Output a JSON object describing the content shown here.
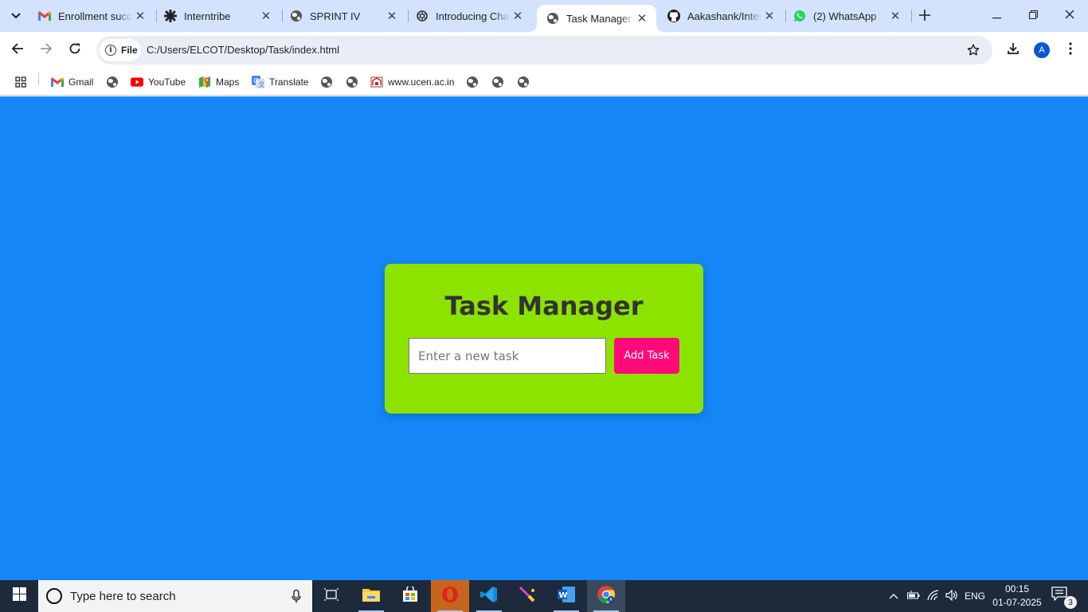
{
  "browser": {
    "tabs": [
      {
        "title": "Enrollment succe",
        "icon": "gmail-icon"
      },
      {
        "title": "Interntribe",
        "icon": "interntribe-icon"
      },
      {
        "title": "SPRINT IV",
        "icon": "globe-icon"
      },
      {
        "title": "Introducing Chat",
        "icon": "chatgpt-icon"
      },
      {
        "title": "Task Manager",
        "icon": "globe-icon",
        "active": true
      },
      {
        "title": "Aakashank/Inter",
        "icon": "github-icon"
      },
      {
        "title": "(2) WhatsApp",
        "icon": "whatsapp-icon"
      }
    ],
    "address": {
      "scheme_chip": "File",
      "url": "C:/Users/ELCOT/Desktop/Task/index.html"
    },
    "profile_initial": "A",
    "bookmarks": {
      "gmail": "Gmail",
      "youtube": "YouTube",
      "maps": "Maps",
      "translate": "Translate",
      "ucen": "www.ucen.ac.in"
    }
  },
  "app": {
    "title": "Task Manager",
    "input_placeholder": "Enter a new task",
    "add_button_label": "Add Task",
    "colors": {
      "page_bg": "#1585f8",
      "card_bg": "#8ce300",
      "button_bg": "#ff0a78",
      "title_color": "#333333"
    }
  },
  "taskbar": {
    "search_placeholder": "Type here to search",
    "language": "ENG",
    "time": "00:15",
    "date": "01-07-2025",
    "notification_count": "3"
  }
}
